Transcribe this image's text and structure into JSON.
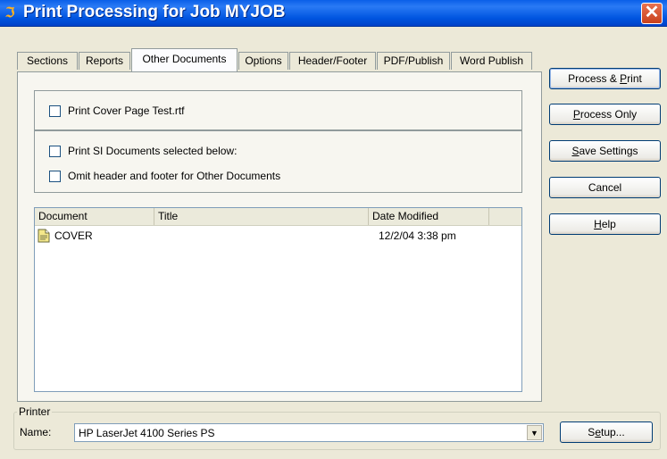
{
  "window": {
    "title": "Print Processing for Job MYJOB",
    "close_glyph": "✕"
  },
  "tabs": [
    {
      "label": "Sections"
    },
    {
      "label": "Reports"
    },
    {
      "label": "Other Documents",
      "active": true
    },
    {
      "label": "Options"
    },
    {
      "label": "Header/Footer"
    },
    {
      "label": "PDF/Publish"
    },
    {
      "label": "Word Publish"
    }
  ],
  "options": {
    "print_cover_page": {
      "label": "Print Cover Page Test.rtf",
      "checked": false
    },
    "print_si_documents": {
      "label": "Print SI Documents selected below:",
      "checked": false
    },
    "omit_header_footer": {
      "label": "Omit header and footer for Other Documents",
      "checked": false
    }
  },
  "document_list": {
    "columns": [
      "Document",
      "Title",
      "Date Modified"
    ],
    "rows": [
      {
        "document": "COVER",
        "title": "",
        "date_modified": "12/2/04 3:38 pm",
        "icon": "document-icon"
      }
    ]
  },
  "buttons": {
    "process_print": {
      "label": "Process & Print",
      "mnemonic": "P"
    },
    "process_only": {
      "label": "Process Only",
      "mnemonic": "P"
    },
    "save_settings": {
      "label": "Save Settings",
      "mnemonic": "S"
    },
    "cancel": {
      "label": "Cancel"
    },
    "help": {
      "label": "Help",
      "mnemonic": "H"
    }
  },
  "printer": {
    "group_label": "Printer",
    "name_label": "Name:",
    "selected": "HP LaserJet 4100 Series PS",
    "setup_label": "Setup..."
  },
  "colors": {
    "titlebar": "#0055e0",
    "dialog_bg": "#ece9d8",
    "close_button": "#d2522f"
  }
}
